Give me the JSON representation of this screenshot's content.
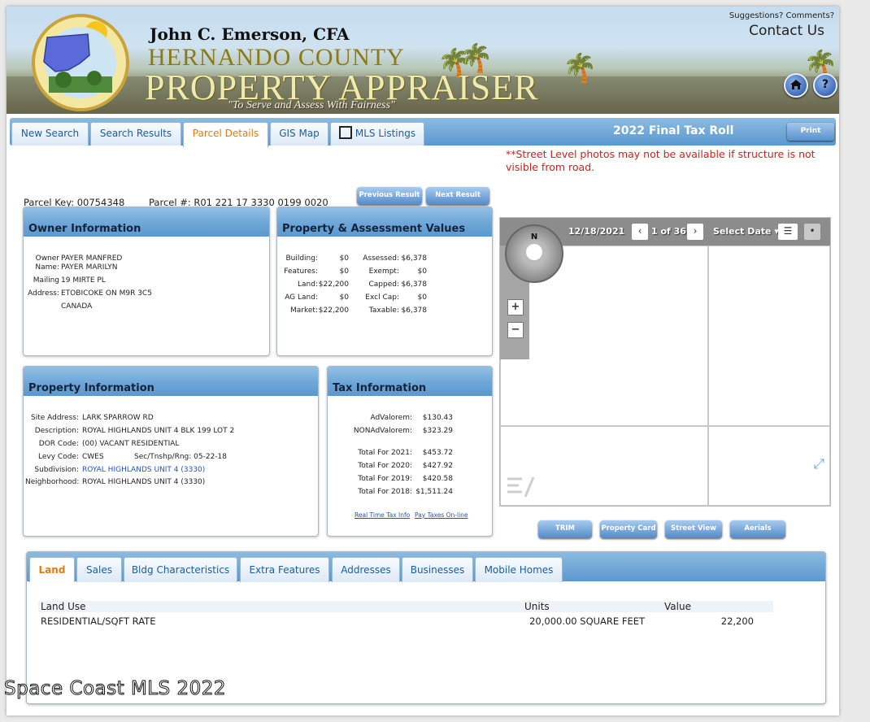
{
  "header": {
    "appraiser": "John C. Emerson, CFA",
    "county": "HERNANDO COUNTY",
    "office": "PROPERTY APPRAISER",
    "motto": "\"To Serve and Assess With Fairness\"",
    "seal_text": "Hernando County Property Appraiser",
    "suggestions": "Suggestions? Comments?",
    "contact": "Contact Us",
    "help_icon": "?"
  },
  "tabs": [
    {
      "label": "New Search"
    },
    {
      "label": "Search Results"
    },
    {
      "label": "Parcel Details"
    },
    {
      "label": "GIS Map"
    },
    {
      "label": "MLS Listings"
    }
  ],
  "tax_roll": "2022 Final Tax Roll",
  "print_label": "Print",
  "notice": "**Street Level photos may not be available if structure is not visible from road.",
  "parcel": {
    "key_label": "Parcel Key:",
    "key": "00754348",
    "num_label": "Parcel #:",
    "num": "R01 221 17 3330 0199 0020",
    "prev": "Previous Result",
    "next": "Next Result"
  },
  "owner": {
    "title": "Owner Information",
    "owner_label": "Owner",
    "name_label": "Name:",
    "owner1": "PAYER MANFRED",
    "owner2": "PAYER MARILYN",
    "mailing_label": "Mailing",
    "address_label": "Address:",
    "addr1": "19 MIRTE PL",
    "addr2": "ETOBICOKE ON M9R 3C5",
    "addr3": "CANADA"
  },
  "values": {
    "title": "Property & Assessment Values",
    "left": [
      {
        "label": "Building:",
        "value": "$0"
      },
      {
        "label": "Features:",
        "value": "$0"
      },
      {
        "label": "Land:",
        "value": "$22,200"
      },
      {
        "label": "AG Land:",
        "value": "$0"
      },
      {
        "label": "Market:",
        "value": "$22,200"
      }
    ],
    "right": [
      {
        "label": "Assessed:",
        "value": "$6,378"
      },
      {
        "label": "Exempt:",
        "value": "$0"
      },
      {
        "label": "Capped:",
        "value": "$6,378"
      },
      {
        "label": "Excl Cap:",
        "value": "$0"
      },
      {
        "label": "Taxable:",
        "value": "$6,378"
      }
    ]
  },
  "property": {
    "title": "Property Information",
    "rows": [
      {
        "label": "Site Address:",
        "value": "LARK SPARROW RD"
      },
      {
        "label": "Description:",
        "value": "ROYAL HIGHLANDS UNIT 4 BLK 199 LOT 2"
      },
      {
        "label": "DOR Code:",
        "value": "(00) VACANT RESIDENTIAL"
      },
      {
        "label": "Levy Code:",
        "value": "CWES"
      },
      {
        "label": "Subdivision:",
        "value": "ROYAL HIGHLANDS UNIT 4 (3330)"
      },
      {
        "label": "Neighborhood:",
        "value": "ROYAL HIGHLANDS UNIT 4 (3330)"
      }
    ],
    "str_label": "Sec/Tnshp/Rng:",
    "str_value": "05-22-18"
  },
  "tax": {
    "title": "Tax Information",
    "rows": [
      {
        "label": "AdValorem:",
        "value": "$130.43"
      },
      {
        "label": "NONAdValorem:",
        "value": "$323.29"
      },
      {
        "label": "Total For 2021:",
        "value": "$453.72"
      },
      {
        "label": "Total For 2020:",
        "value": "$427.92"
      },
      {
        "label": "Total For 2019:",
        "value": "$420.58"
      },
      {
        "label": "Total For 2018:",
        "value": "$1,511.24"
      }
    ],
    "link1": "Real Time Tax Info",
    "link2": "Pay Taxes On-line"
  },
  "map": {
    "date": "12/18/2021",
    "count": "1 of 36",
    "select_date": "Select Date",
    "compass_n": "N",
    "zoom_in": "+",
    "zoom_out": "−"
  },
  "map_buttons": [
    {
      "label": "TRIM"
    },
    {
      "label": "Property Card"
    },
    {
      "label": "Street View"
    },
    {
      "label": "Aerials"
    }
  ],
  "bottom_tabs": [
    {
      "label": "Land"
    },
    {
      "label": "Sales"
    },
    {
      "label": "Bldg Characteristics"
    },
    {
      "label": "Extra Features"
    },
    {
      "label": "Addresses"
    },
    {
      "label": "Businesses"
    },
    {
      "label": "Mobile Homes"
    }
  ],
  "land_table": {
    "headers": [
      "Land Use",
      "Units",
      "Value"
    ],
    "rows": [
      {
        "use": "RESIDENTIAL/SQFT RATE",
        "units": "20,000.00 SQUARE FEET",
        "value": "22,200"
      }
    ]
  },
  "watermark": "Space Coast MLS 2022"
}
